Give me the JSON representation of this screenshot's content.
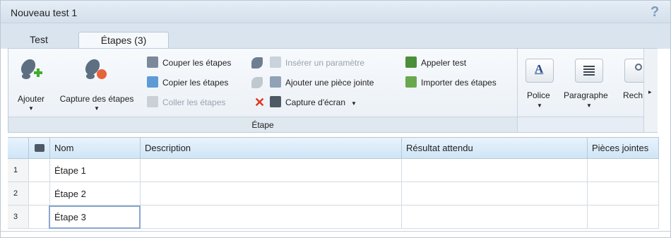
{
  "window": {
    "title": "Nouveau test 1",
    "help_label": "?"
  },
  "tabs": [
    {
      "label": "Test"
    },
    {
      "label": "Étapes (3)"
    }
  ],
  "ribbon": {
    "group_label": "Étape",
    "add_label": "Ajouter",
    "capture_label": "Capture des étapes",
    "cut_label": "Couper les étapes",
    "copy_label": "Copier les étapes",
    "paste_label": "Coller les étapes",
    "insert_param_label": "Insérer un paramètre",
    "attach_label": "Ajouter une pièce jointe",
    "screenshot_label": "Capture d'écran",
    "call_test_label": "Appeler test",
    "import_label": "Importer des étapes",
    "font_label": "Police",
    "paragraph_label": "Paragraphe",
    "search_label": "Rech"
  },
  "grid": {
    "columns": [
      "Nom",
      "Description",
      "Résultat attendu",
      "Pièces jointes"
    ],
    "rows": [
      {
        "num": "1",
        "name": "Étape 1",
        "description": "",
        "expected": "",
        "attachments": ""
      },
      {
        "num": "2",
        "name": "Étape 2",
        "description": "",
        "expected": "",
        "attachments": ""
      },
      {
        "num": "3",
        "name": "Étape 3",
        "description": "",
        "expected": "",
        "attachments": ""
      }
    ]
  },
  "colors": {
    "accent": "#8aa7cf",
    "header_bg": "#d9e4ef",
    "delete_red": "#e0351b",
    "add_green": "#3fae2a"
  }
}
